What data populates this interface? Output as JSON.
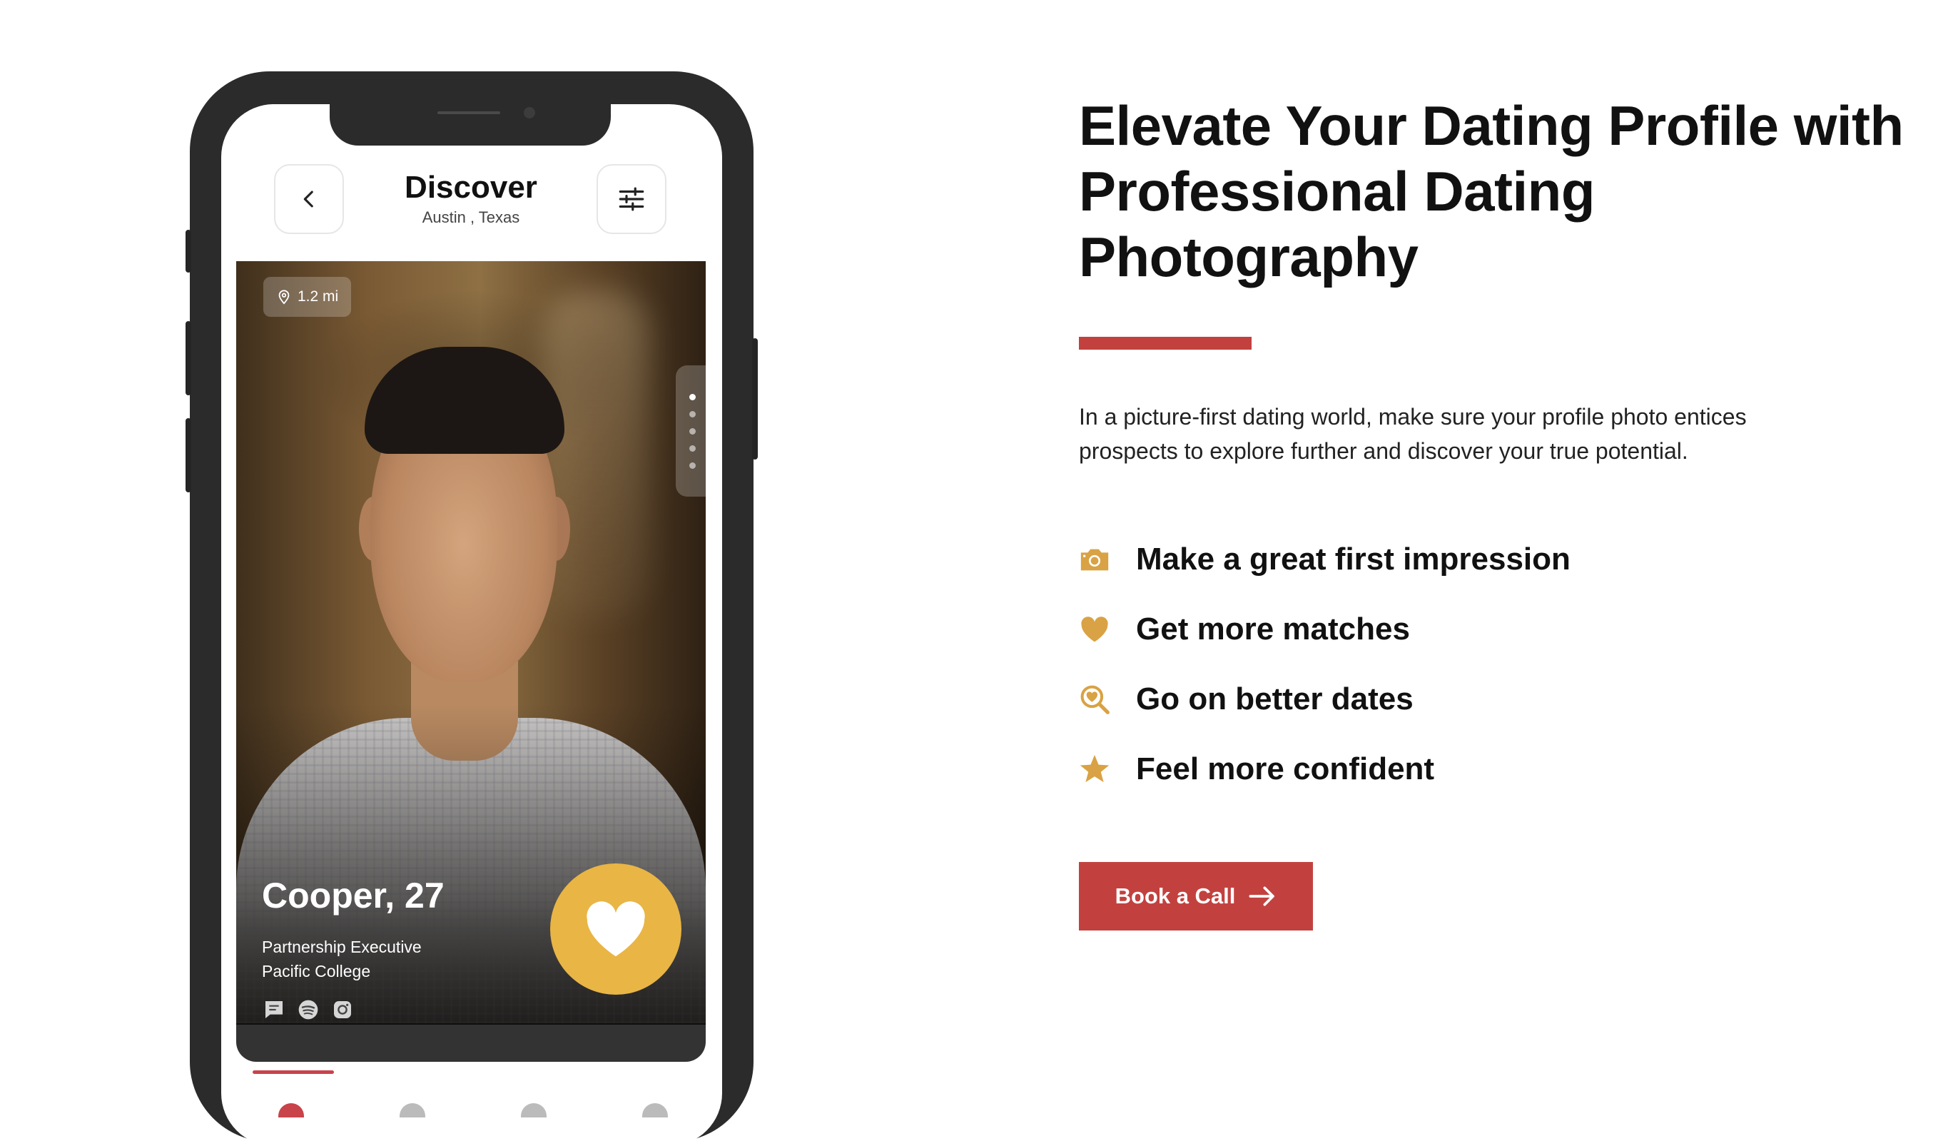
{
  "phone": {
    "header": {
      "title": "Discover",
      "location": "Austin , Texas",
      "back_icon": "chevron-left-icon",
      "filter_icon": "sliders-icon"
    },
    "profile": {
      "distance": "1.2 mi",
      "name_age": "Cooper, 27",
      "job": "Partnership Executive",
      "school": "Pacific College",
      "photo_count": 5,
      "active_photo_index": 1,
      "social_icons": [
        "message-icon",
        "spotify-icon",
        "instagram-icon"
      ],
      "like_icon": "heart-icon"
    },
    "colors": {
      "like_button": "#e9b545",
      "tab_indicator": "#c9434a"
    }
  },
  "content": {
    "headline": "Elevate Your Dating Profile with Professional Dating Photography",
    "intro": "In a picture-first dating world, make sure your profile photo entices prospects to explore further and discover your true potential.",
    "benefits": [
      {
        "icon": "camera-icon",
        "text": "Make a great first impression"
      },
      {
        "icon": "heart-icon",
        "text": "Get more matches"
      },
      {
        "icon": "search-heart-icon",
        "text": "Go on better dates"
      },
      {
        "icon": "star-icon",
        "text": "Feel more confident"
      }
    ],
    "cta": {
      "label": "Book a Call",
      "icon": "arrow-right-icon"
    }
  },
  "colors": {
    "accent_red": "#c2413f",
    "icon_gold": "#d9a244",
    "text_dark": "#111111"
  }
}
